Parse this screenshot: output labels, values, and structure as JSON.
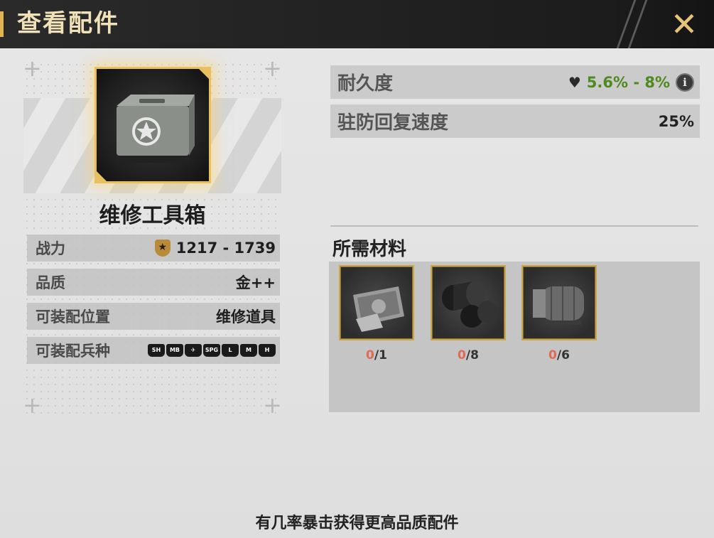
{
  "header": {
    "title": "查看配件",
    "close_icon": "close-icon"
  },
  "item": {
    "name": "维修工具箱",
    "image_icon": "ammo-box-icon",
    "frame_color": "#e8c060"
  },
  "stats": [
    {
      "label": "战力",
      "value": "1217 - 1739",
      "icon": "power-badge-icon"
    },
    {
      "label": "品质",
      "value": "金++"
    },
    {
      "label": "可装配位置",
      "value": "维修道具"
    },
    {
      "label": "可装配兵种",
      "units": [
        "SH",
        "MB",
        "heli",
        "SPG",
        "L",
        "M",
        "H"
      ]
    }
  ],
  "attributes": [
    {
      "label": "耐久度",
      "value": "5.6% - 8%",
      "icon": "heart-icon",
      "color": "#4e8a1e",
      "has_info": true
    },
    {
      "label": "驻防回复速度",
      "value": "25%"
    }
  ],
  "materials": {
    "title": "所需材料",
    "items": [
      {
        "icon": "blueprint-plate-icon",
        "have": "0",
        "need": "/1"
      },
      {
        "icon": "metal-rolls-icon",
        "have": "0",
        "need": "/8"
      },
      {
        "icon": "engine-block-icon",
        "have": "0",
        "need": "/6"
      }
    ]
  },
  "footer": {
    "tip": "有几率暴击获得更高品质配件"
  }
}
